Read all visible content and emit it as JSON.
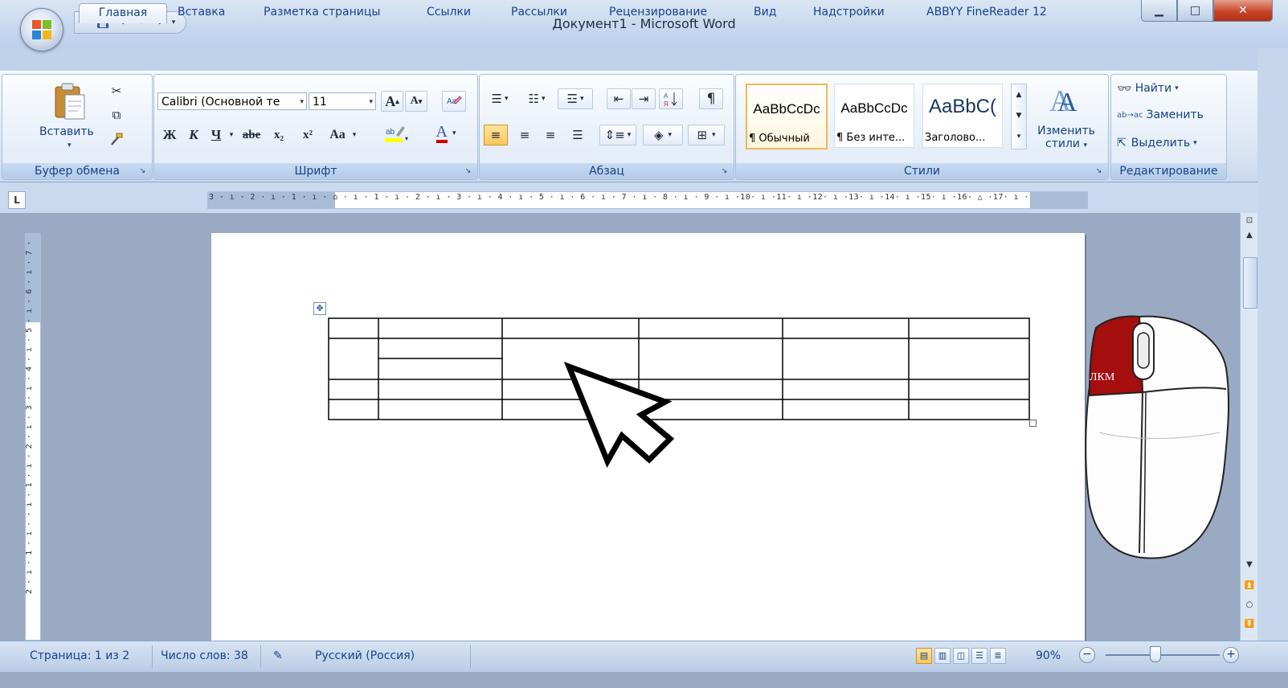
{
  "window": {
    "title": "Документ1 - Microsoft Word"
  },
  "tabs": [
    "Главная",
    "Вставка",
    "Разметка страницы",
    "Ссылки",
    "Рассылки",
    "Рецензирование",
    "Вид",
    "Надстройки",
    "ABBYY FineReader 12"
  ],
  "active_tab": "Главная",
  "clipboard": {
    "paste_label": "Вставить",
    "group_label": "Буфер обмена"
  },
  "font": {
    "name": "Calibri (Основной те",
    "size": "11",
    "group_label": "Шрифт",
    "bold": "Ж",
    "italic": "К",
    "underline": "Ч",
    "strike": "abe",
    "subscript": "x₂",
    "superscript": "x²",
    "change_case": "Aa",
    "grow": "A",
    "shrink": "A",
    "color_letter": "A"
  },
  "paragraph": {
    "group_label": "Абзац",
    "pilcrow": "¶"
  },
  "styles": {
    "group_label": "Стили",
    "items": [
      {
        "sample": "AaBbCcDc",
        "name": "¶ Обычный"
      },
      {
        "sample": "AaBbCcDc",
        "name": "¶ Без инте..."
      },
      {
        "sample": "AaBbC(",
        "name": "Заголово..."
      }
    ],
    "change_label_1": "Изменить",
    "change_label_2": "стили"
  },
  "editing": {
    "group_label": "Редактирование",
    "find": "Найти",
    "replace": "Заменить",
    "select": "Выделить"
  },
  "ruler": {
    "horizontal": "3 · ı · 2 · ı · 1 · ı · ⌂ · ı · 1 · ı · 2 · ı · 3 · ı · 4 · ı · 5 · ı · 6 · ı · 7 · ı · 8 · ı · 9 · ı ·10· ı ·11· ı ·12· ı ·13· ı ·14· ı ·15· ı ·16· △ ·17· ı ·",
    "vertical": "2 · ı · 1 · ı · · ı · 1 · ı · 2 · ı · 3 · ı · 4 · ı · 5 · ı · 6 · ı · 7 ·"
  },
  "mouse": {
    "button_label": "ЛКМ",
    "highlight_color": "#a50e0e"
  },
  "status": {
    "page": "Страница: 1 из 2",
    "words": "Число слов: 38",
    "language": "Русский (Россия)",
    "zoom": "90%"
  },
  "colors": {
    "accent": "#15428b",
    "ribbon_bg": "#dbe6f4",
    "selected_style": "#f2b84e"
  }
}
